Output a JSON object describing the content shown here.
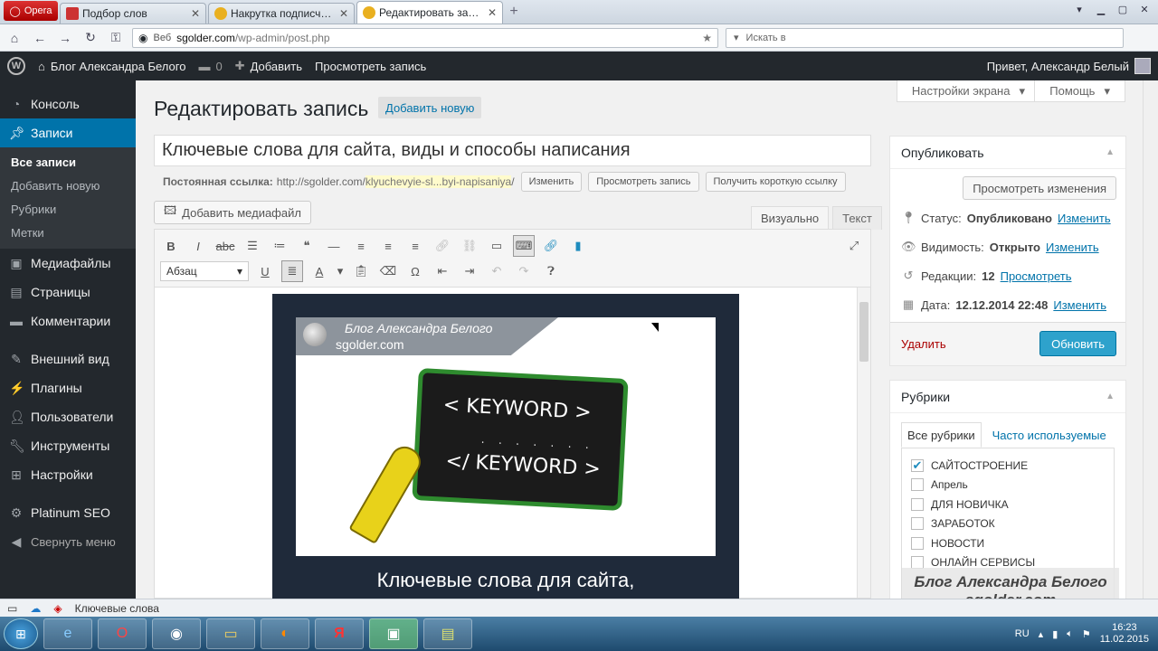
{
  "browser": {
    "opera_label": "Opera",
    "tabs": [
      {
        "title": "Подбор слов",
        "active": false
      },
      {
        "title": "Накрутка подписчико...",
        "active": false
      },
      {
        "title": "Редактировать запись ...",
        "active": true
      }
    ],
    "address": {
      "web_label": "Веб",
      "host": "sgolder.com",
      "path": "/wp-admin/post.php"
    },
    "search_placeholder": "Искать в"
  },
  "admin_bar": {
    "site_name": "Блог Александра Белого",
    "comments_count": "0",
    "add_label": "Добавить",
    "view_label": "Просмотреть запись",
    "greeting": "Привет, Александр Белый"
  },
  "sidebar": {
    "items": [
      {
        "label": "Консоль",
        "icon": "dashboard-icon"
      },
      {
        "label": "Записи",
        "icon": "pin-icon",
        "active": true
      },
      {
        "label": "Медиафайлы",
        "icon": "media-icon"
      },
      {
        "label": "Страницы",
        "icon": "pages-icon"
      },
      {
        "label": "Комментарии",
        "icon": "comment-icon"
      },
      {
        "label": "Внешний вид",
        "icon": "brush-icon"
      },
      {
        "label": "Плагины",
        "icon": "plug-icon"
      },
      {
        "label": "Пользователи",
        "icon": "users-icon"
      },
      {
        "label": "Инструменты",
        "icon": "wrench-icon"
      },
      {
        "label": "Настройки",
        "icon": "settings-icon"
      },
      {
        "label": "Platinum SEO",
        "icon": "gear-icon"
      }
    ],
    "submenu": [
      "Все записи",
      "Добавить новую",
      "Рубрики",
      "Метки"
    ],
    "collapse_label": "Свернуть меню"
  },
  "main": {
    "screen_options": "Настройки экрана",
    "help": "Помощь",
    "heading": "Редактировать запись",
    "add_new": "Добавить новую",
    "post_title": "Ключевые слова для сайта, виды и способы написания",
    "permalink": {
      "label": "Постоянная ссылка:",
      "base": "http://sgolder.com/",
      "slug": "klyuchevyie-sl...byi-napisaniya",
      "end": "/",
      "edit": "Изменить",
      "view": "Просмотреть запись",
      "shortlink": "Получить короткую ссылку"
    },
    "add_media": "Добавить медиафайл",
    "tab_visual": "Визуально",
    "tab_text": "Текст",
    "format_select": "Абзац",
    "image": {
      "banner_line1": "Блог Александра Белого",
      "banner_line2": "sgolder.com",
      "keyword1": "< KEYWORD >",
      "dots": ". . . . . . .",
      "keyword2": "</ KEYWORD >",
      "caption": "Ключевые слова для сайта,"
    }
  },
  "publish": {
    "title": "Опубликовать",
    "preview": "Просмотреть изменения",
    "status_label": "Статус:",
    "status_value": "Опубликовано",
    "visibility_label": "Видимость:",
    "visibility_value": "Открыто",
    "revisions_label": "Редакции:",
    "revisions_value": "12",
    "revisions_link": "Просмотреть",
    "date_label": "Дата:",
    "date_value": "12.12.2014 22:48",
    "change": "Изменить",
    "delete": "Удалить",
    "update": "Обновить"
  },
  "categories": {
    "title": "Рубрики",
    "tab_all": "Все рубрики",
    "tab_popular": "Часто используемые",
    "items": [
      {
        "label": "САЙТОСТРОЕНИЕ",
        "checked": true
      },
      {
        "label": "Апрель",
        "checked": false
      },
      {
        "label": "ДЛЯ НОВИЧКА",
        "checked": false
      },
      {
        "label": "ЗАРАБОТОК",
        "checked": false
      },
      {
        "label": "НОВОСТИ",
        "checked": false
      },
      {
        "label": "ОНЛАЙН СЕРВИСЫ",
        "checked": false
      }
    ]
  },
  "watermark": {
    "line1": "Блог Александра Белого",
    "line2": "sgolder.com"
  },
  "statusbar": {
    "text": "Ключевые слова"
  },
  "taskbar": {
    "lang": "RU",
    "time": "16:23",
    "date": "11.02.2015"
  }
}
